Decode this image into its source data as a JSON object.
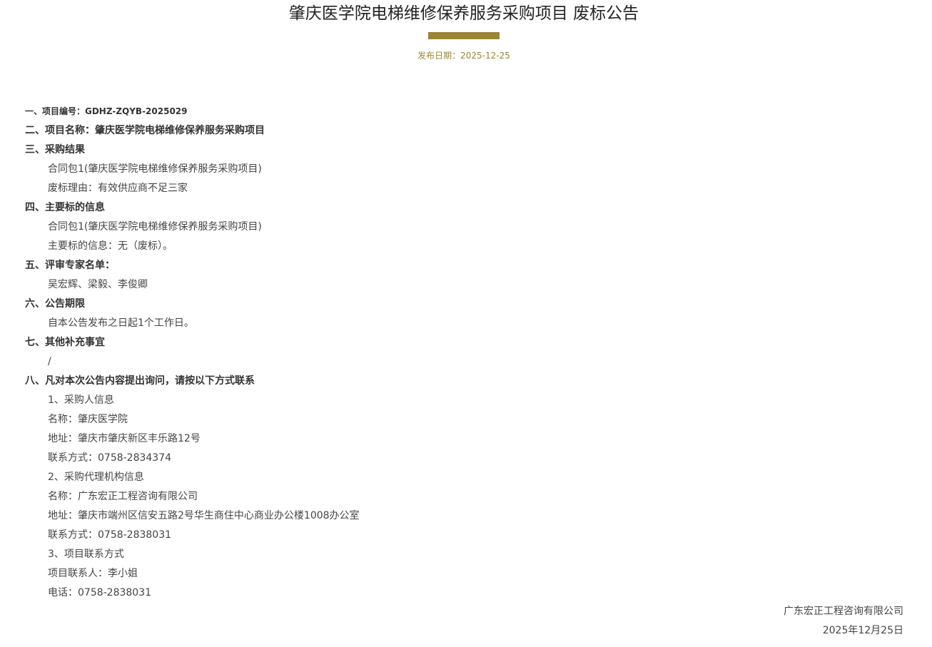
{
  "notice": {
    "title": "肇庆医学院电梯维修保养服务采购项目 废标公告",
    "publish_date_label": "发布日期：",
    "publish_date": "2025-12-25"
  },
  "sections": [
    {
      "kind": "heading-small",
      "text": "一、项目编号：GDHZ-ZQYB-2025029"
    },
    {
      "kind": "heading",
      "text": "二、项目名称：肇庆医学院电梯维修保养服务采购项目"
    },
    {
      "kind": "heading",
      "text": "三、采购结果"
    },
    {
      "kind": "indent",
      "text": "合同包1(肇庆医学院电梯维修保养服务采购项目)"
    },
    {
      "kind": "indent",
      "text": "废标理由：有效供应商不足三家"
    },
    {
      "kind": "heading",
      "text": "四、主要标的信息"
    },
    {
      "kind": "indent",
      "text": "合同包1(肇庆医学院电梯维修保养服务采购项目)"
    },
    {
      "kind": "indent",
      "text": "主要标的信息：无（废标）。"
    },
    {
      "kind": "heading",
      "text": "五、评审专家名单："
    },
    {
      "kind": "indent",
      "text": "吴宏辉、梁毅、李俊卿"
    },
    {
      "kind": "heading",
      "text": "六、公告期限"
    },
    {
      "kind": "indent",
      "text": "自本公告发布之日起1个工作日。"
    },
    {
      "kind": "heading",
      "text": "七、其他补充事宜"
    },
    {
      "kind": "indent",
      "text": "/"
    },
    {
      "kind": "heading",
      "text": "八、凡对本次公告内容提出询问，请按以下方式联系"
    },
    {
      "kind": "indent",
      "text": "1、采购人信息"
    },
    {
      "kind": "indent",
      "text": "名称：肇庆医学院"
    },
    {
      "kind": "indent",
      "text": "地址：肇庆市肇庆新区丰乐路12号"
    },
    {
      "kind": "indent",
      "text": "联系方式：0758-2834374"
    },
    {
      "kind": "indent",
      "text": "2、采购代理机构信息"
    },
    {
      "kind": "indent",
      "text": "名称：广东宏正工程咨询有限公司"
    },
    {
      "kind": "indent",
      "text": "地址：肇庆市端州区信安五路2号华生商住中心商业办公楼1008办公室"
    },
    {
      "kind": "indent",
      "text": "联系方式：0758-2838031"
    },
    {
      "kind": "indent",
      "text": "3、项目联系方式"
    },
    {
      "kind": "indent",
      "text": "项目联系人：李小姐"
    },
    {
      "kind": "indent",
      "text": "电话：0758-2838031"
    }
  ],
  "signature": {
    "company": "广东宏正工程咨询有限公司",
    "date": "2025年12月25日"
  },
  "colors": {
    "accent": "#9a8532",
    "text": "#333333"
  }
}
